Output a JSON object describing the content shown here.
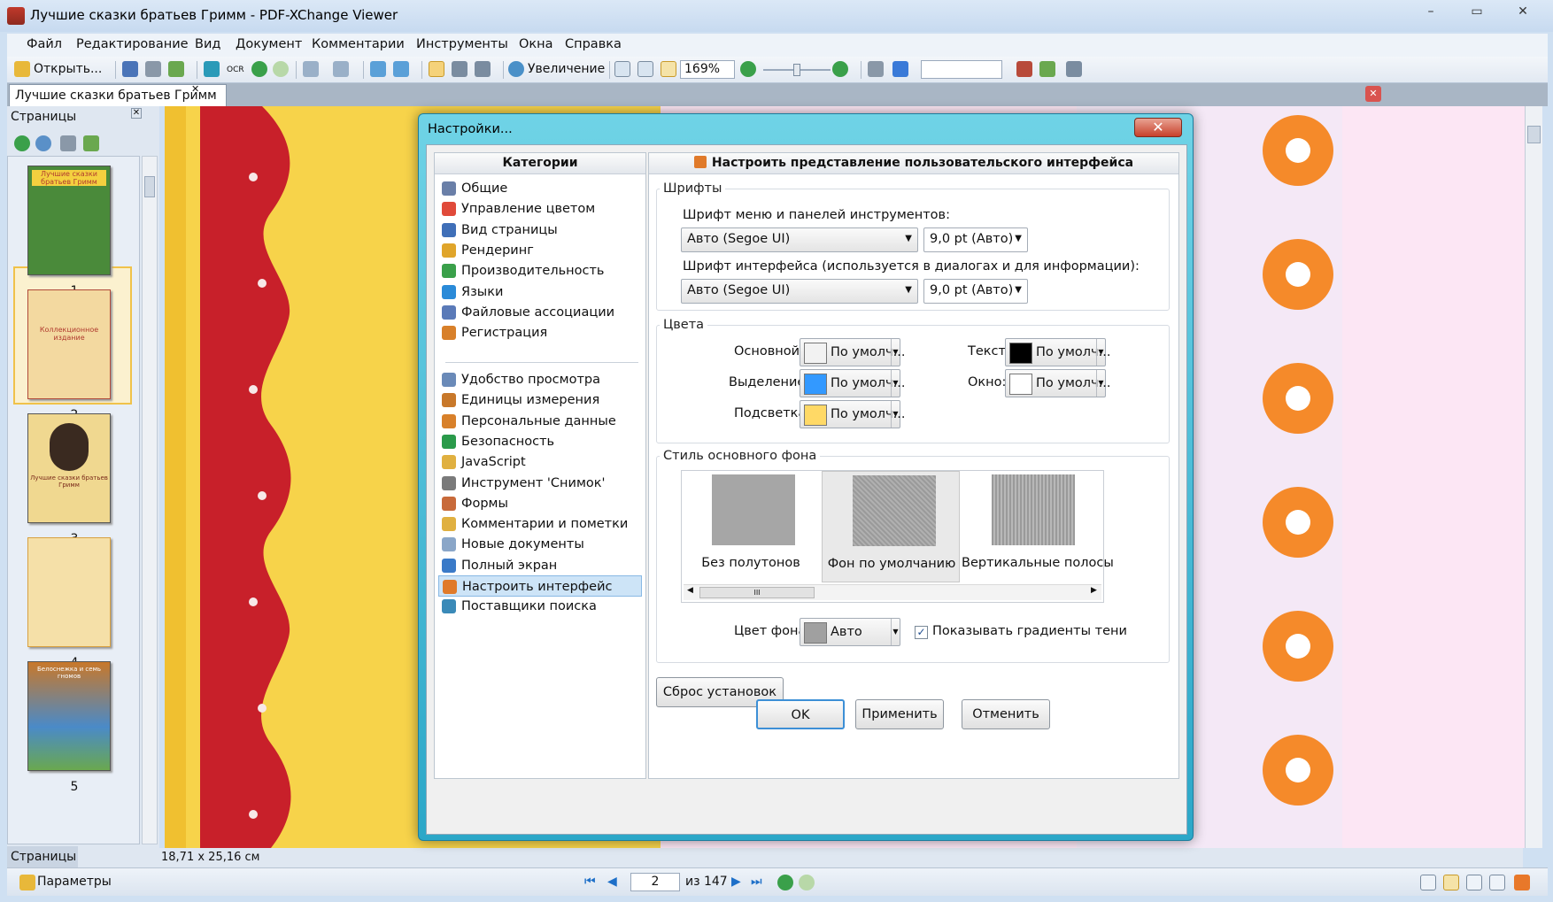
{
  "window": {
    "title": "Лучшие сказки братьев Гримм - PDF-XChange Viewer",
    "controls": [
      "–",
      "▭",
      "✕"
    ]
  },
  "menu": [
    "Файл",
    "Редактирование",
    "Вид",
    "Документ",
    "Комментарии",
    "Инструменты",
    "Окна",
    "Справка"
  ],
  "toolbar": {
    "open_label": "Открыть...",
    "ocr_label": "OCR",
    "zoom_tool_label": "Увеличение",
    "zoom_value": "169%",
    "search_value": ""
  },
  "doc_tab": {
    "label": "Лучшие сказки братьев Гримм",
    "close": "✕"
  },
  "sidebar": {
    "title": "Страницы",
    "close": "✕",
    "footer_tab": "Страницы",
    "thumbnails": [
      {
        "num": "1",
        "color": "#4a8a3a",
        "text": "Лучшие сказки братьев Гримм"
      },
      {
        "num": "2",
        "color": "#f3d9a0",
        "text": "Коллекционное издание"
      },
      {
        "num": "3",
        "color": "#f0d890",
        "text": "Лучшие сказки братьев Гримм"
      },
      {
        "num": "4",
        "color": "#f5e0a8",
        "text": ""
      },
      {
        "num": "5",
        "color": "#c8782a",
        "text": "Белоснежка и семь гномов"
      }
    ]
  },
  "page_size": "18,71 x 25,16 см",
  "status": {
    "params_label": "Параметры",
    "page_input": "2",
    "page_total": "из 147"
  },
  "dialog": {
    "title": "Настройки...",
    "close": "✕",
    "categories_header": "Категории",
    "categories_group1": [
      {
        "label": "Общие",
        "icon": "general-icon",
        "color": "#6a7fa8"
      },
      {
        "label": "Управление цветом",
        "icon": "color-management-icon",
        "color": "#e04a3a"
      },
      {
        "label": "Вид страницы",
        "icon": "page-view-icon",
        "color": "#3f6fb8"
      },
      {
        "label": "Рендеринг",
        "icon": "rendering-icon",
        "color": "#e0a52a"
      },
      {
        "label": "Производительность",
        "icon": "performance-icon",
        "color": "#3aa04a"
      },
      {
        "label": "Языки",
        "icon": "languages-icon",
        "color": "#2a8ad8"
      },
      {
        "label": "Файловые ассоциации",
        "icon": "file-associations-icon",
        "color": "#5a7ab8"
      },
      {
        "label": "Регистрация",
        "icon": "registration-icon",
        "color": "#d8802a"
      }
    ],
    "categories_group2": [
      {
        "label": "Удобство просмотра",
        "icon": "accessibility-icon",
        "color": "#6a8ab8"
      },
      {
        "label": "Единицы измерения",
        "icon": "units-icon",
        "color": "#c8782a"
      },
      {
        "label": "Персональные данные",
        "icon": "identity-icon",
        "color": "#d8802a"
      },
      {
        "label": "Безопасность",
        "icon": "security-icon",
        "color": "#2a9a4a"
      },
      {
        "label": "JavaScript",
        "icon": "javascript-icon",
        "color": "#e0b040"
      },
      {
        "label": "Инструмент 'Снимок'",
        "icon": "snapshot-icon",
        "color": "#7a7a7a"
      },
      {
        "label": "Формы",
        "icon": "forms-icon",
        "color": "#c86a3a"
      },
      {
        "label": "Комментарии и пометки",
        "icon": "comments-icon",
        "color": "#e0b040"
      },
      {
        "label": "Новые документы",
        "icon": "new-documents-icon",
        "color": "#8aa6c8"
      },
      {
        "label": "Полный экран",
        "icon": "full-screen-icon",
        "color": "#3a7ac8"
      },
      {
        "label": "Настроить интерфейс",
        "icon": "customize-ui-icon",
        "color": "#e07a2a"
      },
      {
        "label": "Поставщики поиска",
        "icon": "search-providers-icon",
        "color": "#3a8ab8"
      }
    ],
    "selected_category": "Настроить интерфейс",
    "section_title": "Настроить представление пользовательского интерфейса",
    "fonts": {
      "group_label": "Шрифты",
      "menu_font_label": "Шрифт меню и панелей инструментов:",
      "menu_font_value": "Авто (Segoe UI)",
      "menu_font_size": "9,0 pt (Авто)",
      "ui_font_label": "Шрифт интерфейса (используется в диалогах и для информации):",
      "ui_font_value": "Авто (Segoe UI)",
      "ui_font_size": "9,0 pt (Авто)"
    },
    "colors": {
      "group_label": "Цвета",
      "main_label": "Основной:",
      "main_value": "По умолч...",
      "main_swatch": "#f2f2f2",
      "selection_label": "Выделение:",
      "selection_value": "По умолч...",
      "selection_swatch": "#3399ff",
      "highlight_label": "Подсветка:",
      "highlight_value": "По умолч...",
      "highlight_swatch": "#ffd966",
      "text_label": "Текст:",
      "text_value": "По умолч...",
      "text_swatch": "#000000",
      "window_label": "Окно:",
      "window_value": "По умолч...",
      "window_swatch": "#ffffff"
    },
    "background": {
      "group_label": "Стиль основного фона",
      "options": [
        {
          "label": "Без полутонов"
        },
        {
          "label": "Фон по умолчанию"
        },
        {
          "label": "Вертикальные полосы"
        }
      ],
      "selected": "Фон по умолчанию",
      "scroll_grip": "III",
      "bg_color_label": "Цвет фона:",
      "bg_color_value": "Авто",
      "bg_color_swatch": "#a0a0a0",
      "gradient_label": "Показывать градиенты тени",
      "gradient_checked": "✓"
    },
    "reset_button": "Сброс установок",
    "ok_button": "OK",
    "apply_button": "Применить",
    "cancel_button": "Отменить"
  }
}
